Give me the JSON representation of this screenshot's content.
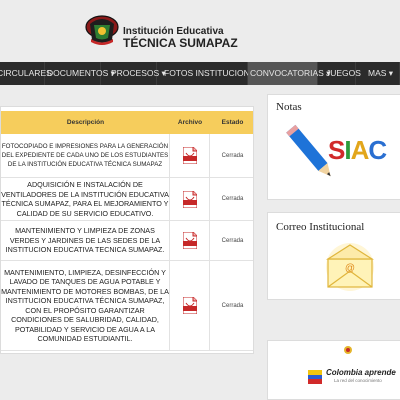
{
  "header": {
    "title_line1": "Institución Educativa",
    "title_line2": "TÉCNICA SUMAPAZ"
  },
  "nav": {
    "items": [
      {
        "label": "CIRCULARES",
        "has_caret": false
      },
      {
        "label": "DOCUMENTOS",
        "has_caret": true
      },
      {
        "label": "PROCESOS",
        "has_caret": true
      },
      {
        "label": "FOTOS INSTITUCIONALES",
        "has_caret": false
      },
      {
        "label": "CONVOCATORIAS",
        "has_caret": true,
        "active": true
      },
      {
        "label": "JUEGOS",
        "has_caret": false
      },
      {
        "label": "MAS",
        "has_caret": true
      }
    ]
  },
  "table": {
    "headers": {
      "description": "Descripción",
      "file": "Archivo",
      "state": "Estado"
    },
    "rows": [
      {
        "description": "FOTOCOPIADO E IMPRESIONES PARA LA GENERACIÓN DEL EXPEDIENTE DE CADA UNO DE LOS ESTUDIANTES DE LA INSTITUCIÓN EDUCATIVA TÉCNICA SUMAPAZ",
        "state": "Cerrada"
      },
      {
        "description": "ADQUISICIÓN E INSTALACIÓN DE VENTILADORES DE LA INSTITUCIÓN EDUCATIVA TÉCNICA SUMAPAZ, PARA EL MEJORAMIENTO Y CALIDAD DE SU SERVICIO EDUCATIVO.",
        "state": "Cerrada"
      },
      {
        "description": "MANTENIMIENTO Y LIMPIEZA DE ZONAS VERDES Y JARDINES DE LAS SEDES DE LA INSTITUCION EDUCATIVA TECNICA SUMAPAZ.",
        "state": "Cerrada"
      },
      {
        "description": "MANTENIMIENTO, LIMPIEZA, DESINFECCIÓN Y LAVADO DE TANQUES DE AGUA POTABLE Y MANTENIMIENTO DE MOTORES BOMBAS, DE LA INSTITUCION EDUCATIVA TÉCNICA SUMAPAZ, CON EL PROPÓSITO GARANTIZAR CONDICIONES DE SALUBRIDAD, CALIDAD, POTABILIDAD Y SERVICIO DE AGUA A LA COMUNIDAD ESTUDIANTIL.",
        "state": "Cerrada"
      }
    ]
  },
  "sidebar": {
    "notas_title": "Notas",
    "siac_text": "SIAC",
    "correo_title": "Correo Institucional",
    "colombia_text": "Colombia aprende",
    "colombia_sub": "La red del conocimiento"
  },
  "colors": {
    "nav_bg": "#2b2b2b",
    "nav_active": "#555555",
    "table_header": "#f6cd5c",
    "pdf_red": "#c62828"
  }
}
